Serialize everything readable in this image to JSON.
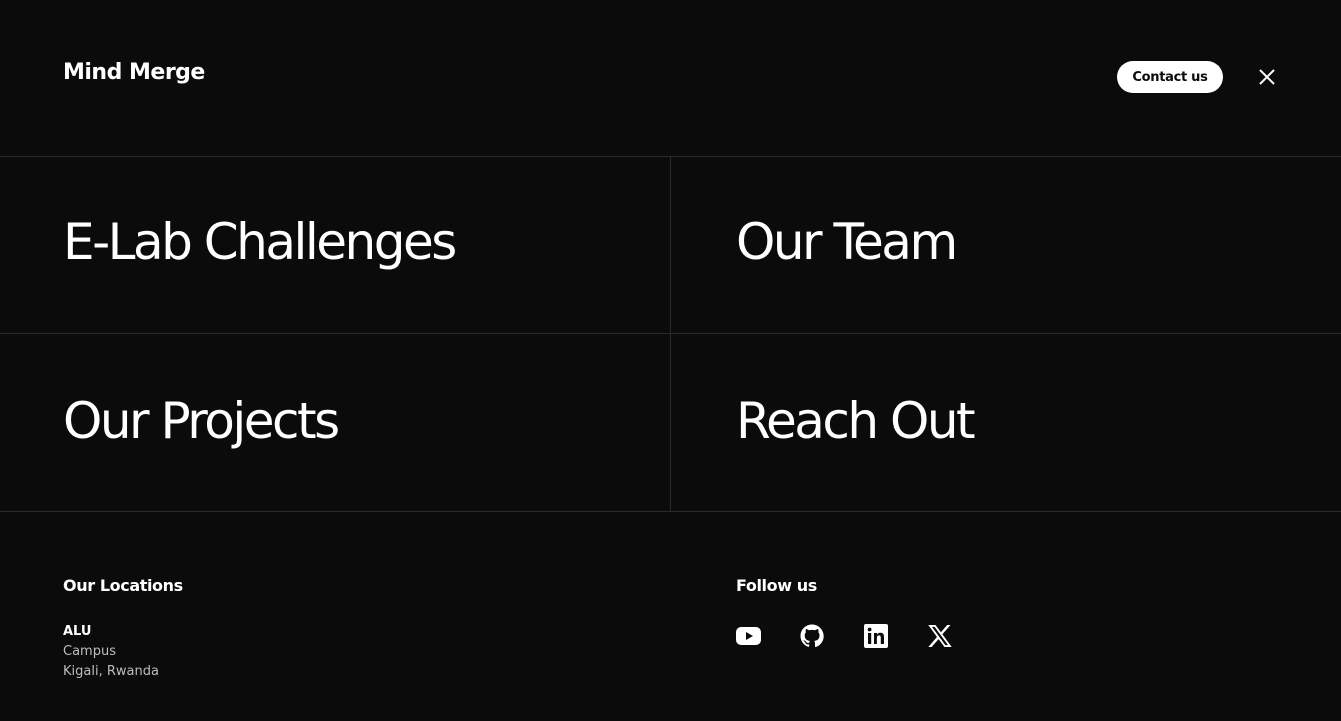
{
  "header": {
    "brand": "Mind Merge",
    "contact_label": "Contact us",
    "close_icon": "close-icon"
  },
  "menu": {
    "items": [
      {
        "label": "E-Lab Challenges"
      },
      {
        "label": "Our Team"
      },
      {
        "label": "Our Projects"
      },
      {
        "label": "Reach Out"
      }
    ]
  },
  "footer": {
    "locations_heading": "Our Locations",
    "location": {
      "name": "ALU",
      "line1": "Campus",
      "line2": "Kigali, Rwanda"
    },
    "follow_heading": "Follow us",
    "social": [
      {
        "icon": "youtube-icon"
      },
      {
        "icon": "github-icon"
      },
      {
        "icon": "linkedin-icon"
      },
      {
        "icon": "x-icon"
      }
    ]
  },
  "colors": {
    "background": "#0b0b0b",
    "text": "#ffffff",
    "muted_text": "#bdbdbd",
    "divider": "#2a2a2a"
  }
}
